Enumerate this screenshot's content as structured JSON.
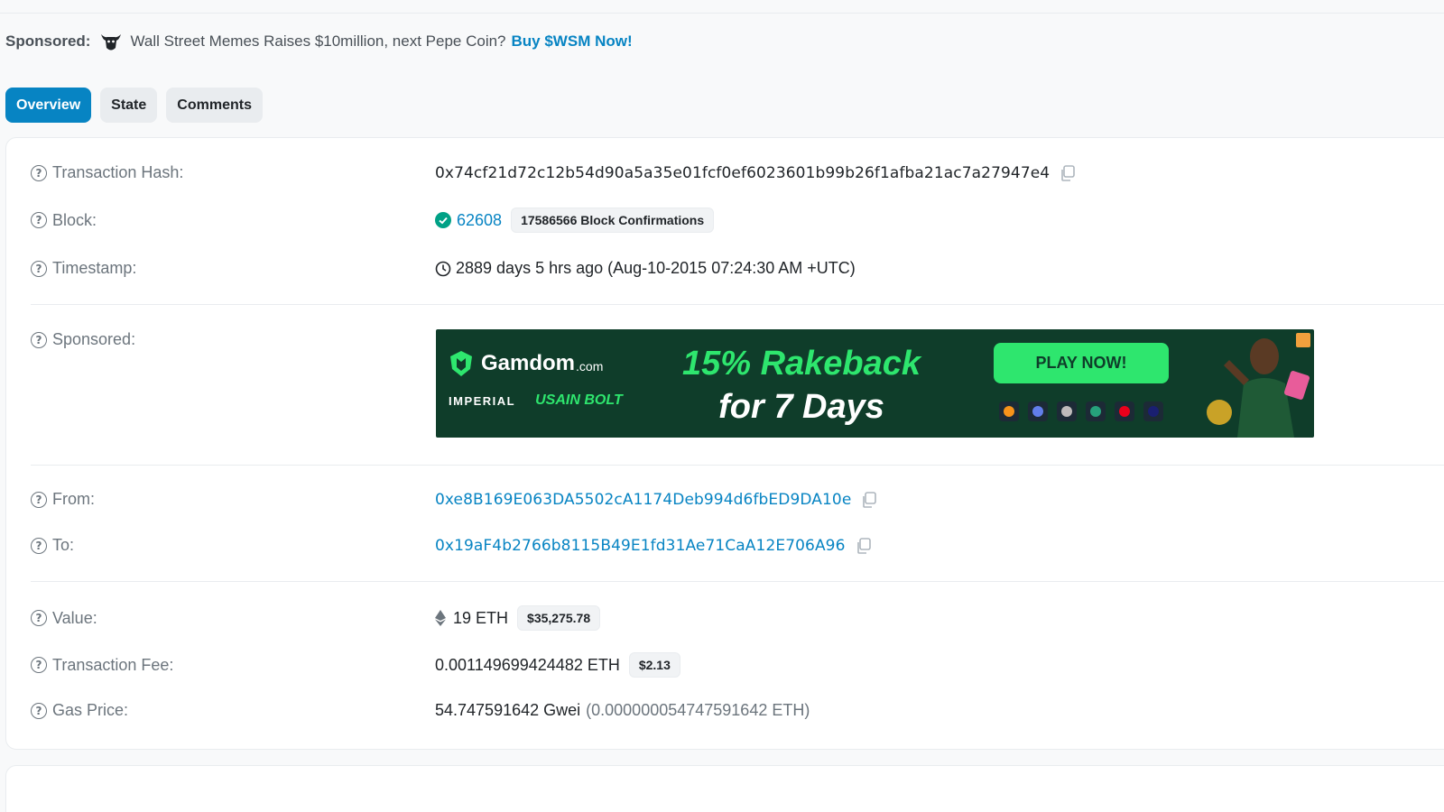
{
  "sponsor": {
    "label": "Sponsored:",
    "text": "Wall Street Memes Raises $10million, next Pepe Coin?",
    "link": "Buy $WSM Now!"
  },
  "tabs": [
    {
      "label": "Overview",
      "active": true
    },
    {
      "label": "State",
      "active": false
    },
    {
      "label": "Comments",
      "active": false
    }
  ],
  "tx": {
    "hash_label": "Transaction Hash:",
    "hash": "0x74cf21d72c12b54d90a5a35e01fcf0ef6023601b99b26f1afba21ac7a27947e4",
    "block_label": "Block:",
    "block": "62608",
    "confirmations": "17586566 Block Confirmations",
    "timestamp_label": "Timestamp:",
    "timestamp": "2889 days 5 hrs ago (Aug-10-2015 07:24:30 AM +UTC)",
    "sponsored_label": "Sponsored:",
    "from_label": "From:",
    "from": "0xe8B169E063DA5502cA1174Deb994d6fbED9DA10e",
    "to_label": "To:",
    "to": "0x19aF4b2766b8115B49E1fd31Ae71CaA12E706A96",
    "value_label": "Value:",
    "value": "19 ETH",
    "value_usd": "$35,275.78",
    "fee_label": "Transaction Fee:",
    "fee": "0.001149699424482 ETH",
    "fee_usd": "$2.13",
    "gas_label": "Gas Price:",
    "gas": "54.747591642 Gwei",
    "gas_eth": "(0.000000054747591642 ETH)"
  },
  "banner": {
    "brand": "Gamdom",
    "brand_suffix": ".com",
    "partner1": "IMPERIAL",
    "partner2": "USAIN BOLT",
    "headline1": "15% Rakeback",
    "headline2": "for 7 Days",
    "cta": "PLAY NOW!"
  },
  "colors": {
    "accent": "#0784c3",
    "banner_bg": "#0f3d2a",
    "banner_green": "#2ee66e",
    "success": "#00a186"
  }
}
